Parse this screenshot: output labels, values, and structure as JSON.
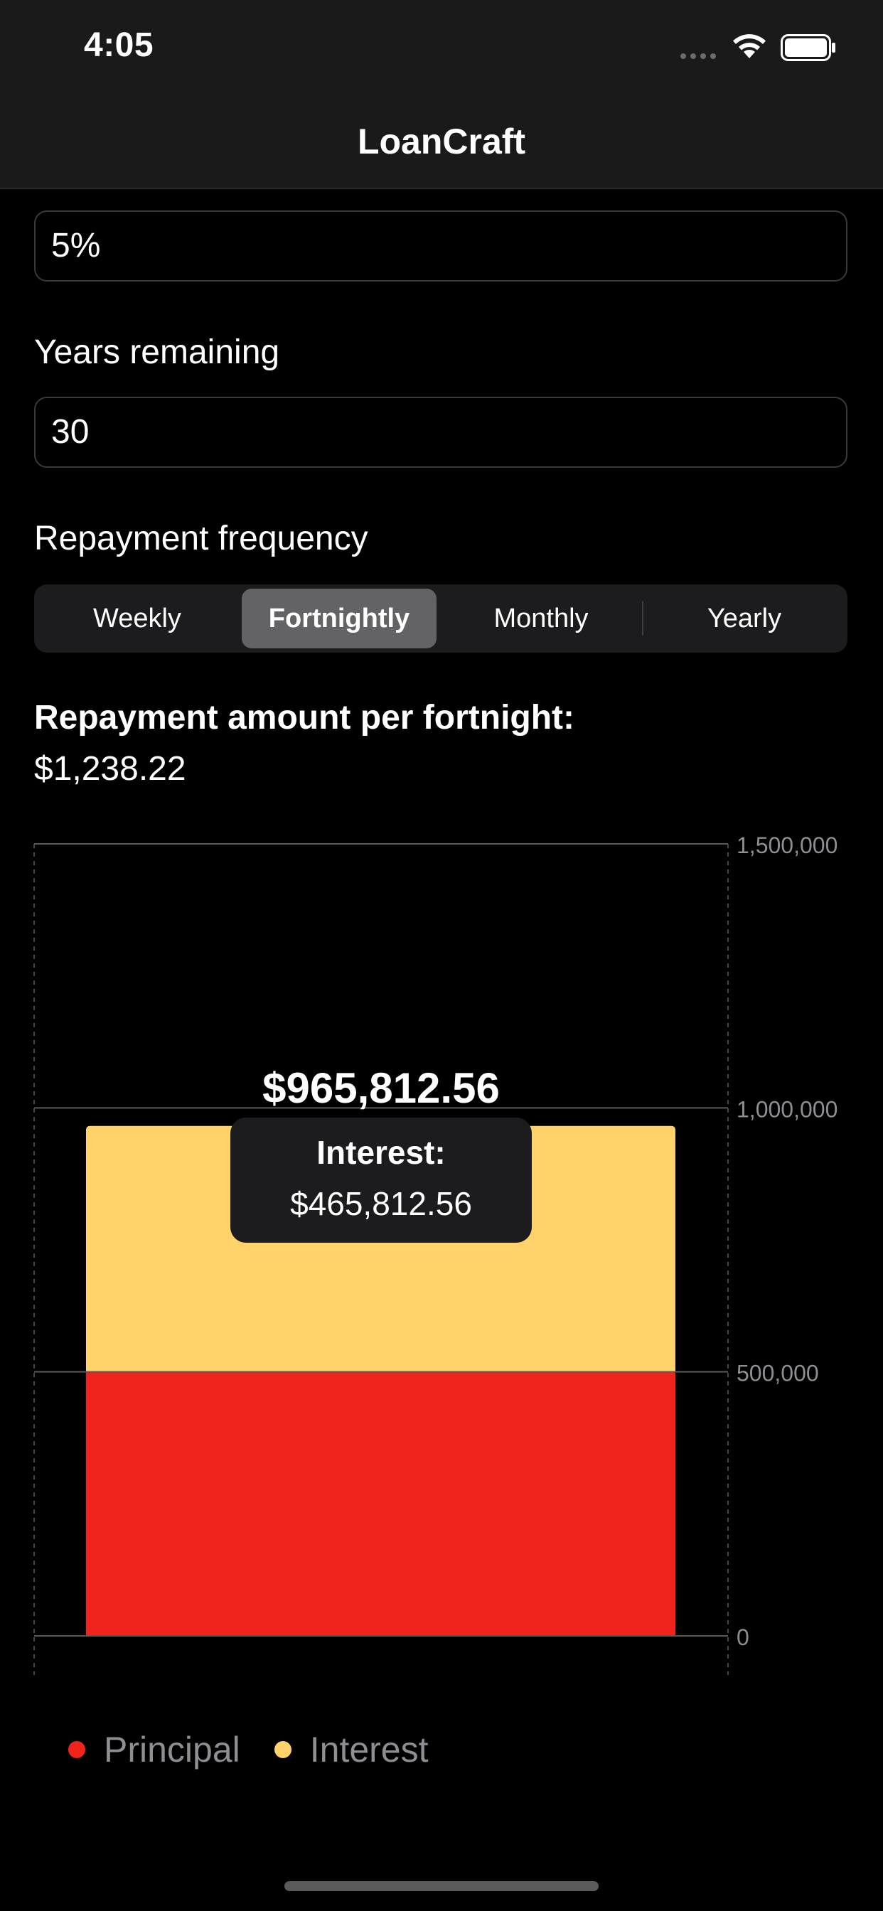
{
  "status_bar": {
    "time": "4:05"
  },
  "nav": {
    "title": "LoanCraft"
  },
  "form": {
    "interest_rate_value": "5%",
    "years_label": "Years remaining",
    "years_value": "30",
    "frequency_label": "Repayment frequency",
    "frequency_options": [
      "Weekly",
      "Fortnightly",
      "Monthly",
      "Yearly"
    ],
    "frequency_selected": "Fortnightly"
  },
  "result": {
    "label": "Repayment amount per fortnight:",
    "value": "$1,238.22"
  },
  "chart_data": {
    "type": "bar",
    "stacked": true,
    "categories": [
      ""
    ],
    "series": [
      {
        "name": "Principal",
        "values": [
          500000
        ],
        "color": "#f0241a"
      },
      {
        "name": "Interest",
        "values": [
          465812.56
        ],
        "color": "#ffd36a"
      }
    ],
    "total_label": "$965,812.56",
    "tooltip": {
      "title": "Interest:",
      "value": "$465,812.56"
    },
    "ylim": [
      0,
      1500000
    ],
    "yticks": [
      0,
      500000,
      1000000,
      1500000
    ],
    "ytick_labels": [
      "0",
      "500,000",
      "1,000,000",
      "1,500,000"
    ],
    "y_axis_position": "right",
    "grid": true,
    "legend_position": "bottom-left"
  }
}
